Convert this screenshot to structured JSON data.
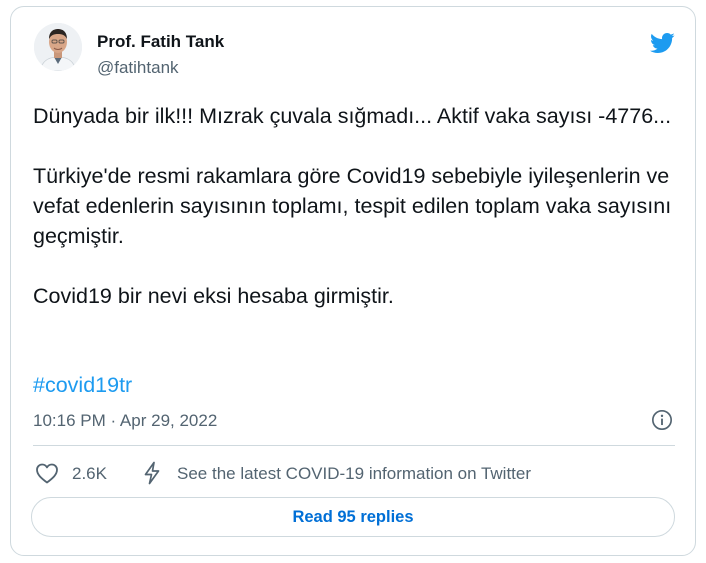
{
  "author": {
    "name": "Prof. Fatih Tank",
    "handle": "@fatihtank"
  },
  "tweet": {
    "paragraphs": [
      "Dünyada bir ilk!!! Mızrak çuvala sığmadı... Aktif vaka sayısı -4776...",
      "Türkiye'de resmi rakamlara göre Covid19 sebebiyle iyileşenlerin ve vefat edenlerin sayısının toplamı, tespit edilen toplam vaka sayısını geçmiştir.",
      "Covid19 bir nevi eksi hesaba girmiştir."
    ],
    "hashtag": "#covid19tr",
    "timestamp": "10:16 PM · Apr 29, 2022"
  },
  "actions": {
    "like_count": "2.6K",
    "covid_info": "See the latest COVID-19 information on Twitter",
    "read_replies": "Read 95 replies"
  },
  "icons": {
    "brand": "twitter-bird-icon",
    "info": "info-icon",
    "like": "heart-icon",
    "covid": "lightning-bolt-icon"
  },
  "colors": {
    "accent": "#1d9bf0",
    "link": "#006fd6",
    "text_primary": "#0f1419",
    "text_secondary": "#536471",
    "border": "#cfd9de"
  }
}
